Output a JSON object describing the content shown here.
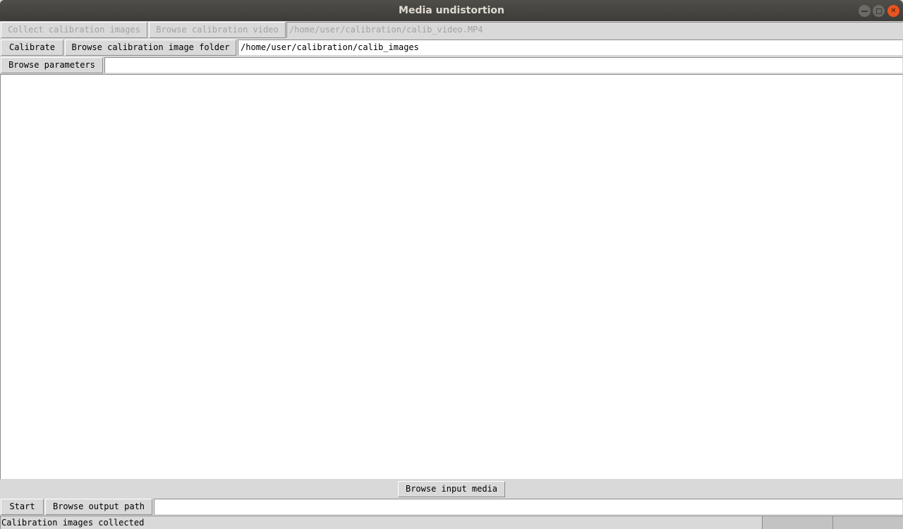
{
  "window": {
    "title": "Media undistortion",
    "controls": {
      "minimize": "minimize-icon",
      "maximize": "maximize-icon",
      "close": "close-icon"
    }
  },
  "row1": {
    "collect_button": "Collect calibration images",
    "browse_video_button": "Browse calibration video",
    "video_path": "/home/user/calibration/calib_video.MP4"
  },
  "row2": {
    "calibrate_button": "Calibrate",
    "browse_folder_button": "Browse calibration image folder",
    "folder_path": "/home/user/calibration/calib_images"
  },
  "row3": {
    "browse_params_button": "Browse parameters",
    "params_path": ""
  },
  "bottom": {
    "browse_input_button": "Browse input media",
    "start_button": "Start",
    "browse_output_button": "Browse output path",
    "output_path": ""
  },
  "status": {
    "message": "Calibration images collected",
    "segment2": "",
    "segment3": ""
  }
}
